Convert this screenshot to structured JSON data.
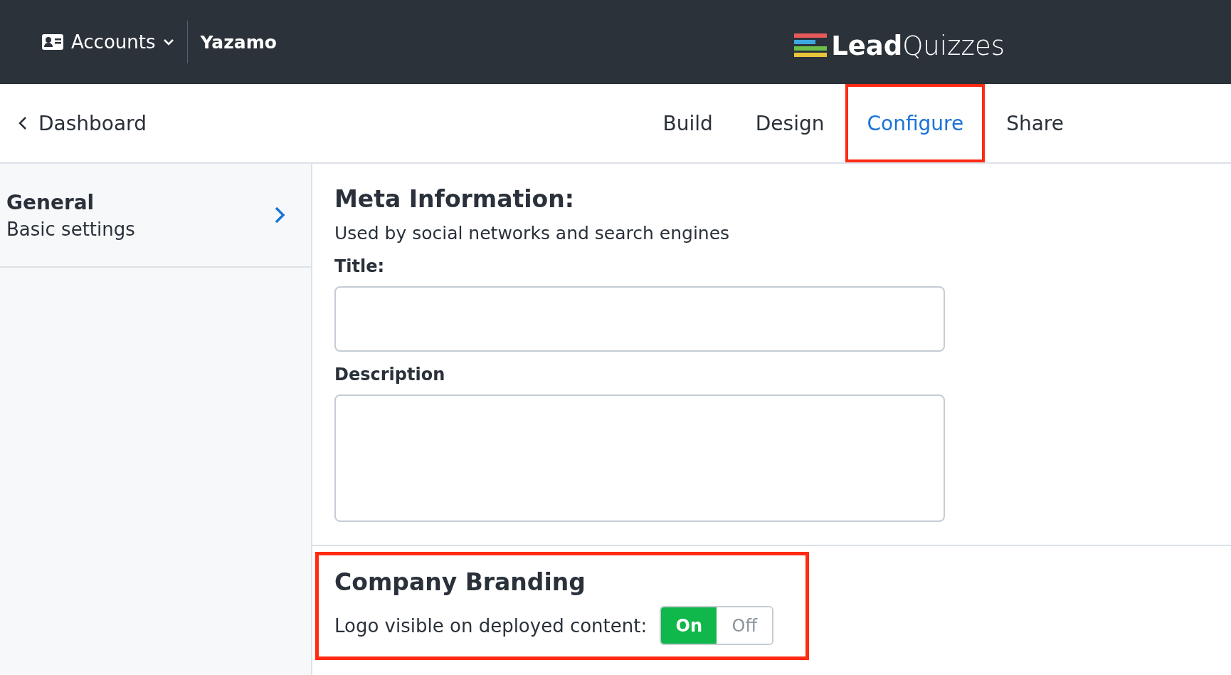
{
  "topbar": {
    "accounts_label": "Accounts",
    "account_name": "Yazamo",
    "logo": "**Lead**Quizzes"
  },
  "nav": {
    "back_label": "Dashboard",
    "tabs": [
      {
        "label": "Build",
        "selected": false,
        "highlighted": false
      },
      {
        "label": "Design",
        "selected": false,
        "highlighted": false
      },
      {
        "label": "Configure",
        "selected": true,
        "highlighted": true
      },
      {
        "label": "Share",
        "selected": false,
        "highlighted": false
      }
    ]
  },
  "sidebar": {
    "items": [
      {
        "title": "General",
        "subtitle": "Basic settings"
      }
    ]
  },
  "meta": {
    "heading": "Meta Information:",
    "subheading": "Used by social networks and search engines",
    "fields": [
      {
        "kind": "input",
        "label": "Title:"
      },
      {
        "kind": "textarea",
        "label": "Description"
      }
    ]
  },
  "branding": {
    "highlighted": true,
    "heading": "Company Branding",
    "label": "Logo visible on deployed content:",
    "on_label": "On",
    "off_label": "Off",
    "on": true
  }
}
